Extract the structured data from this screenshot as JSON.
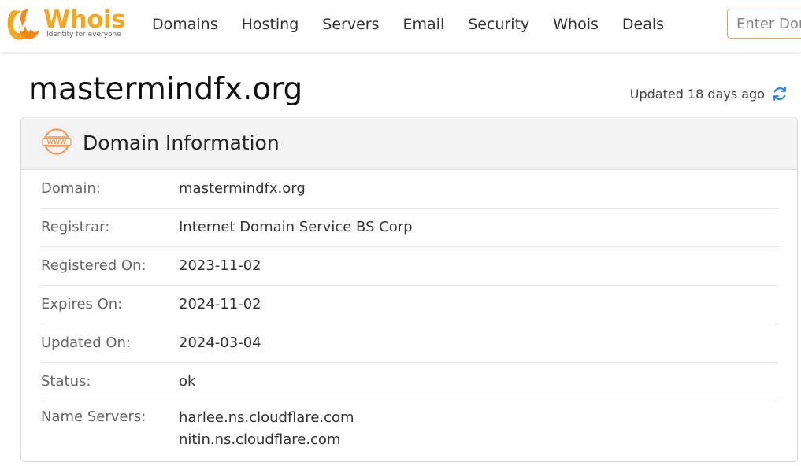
{
  "header": {
    "logo_word": "Whois",
    "logo_tagline": "Identity for everyone",
    "nav": [
      "Domains",
      "Hosting",
      "Servers",
      "Email",
      "Security",
      "Whois",
      "Deals"
    ],
    "search_placeholder": "Enter Domain"
  },
  "page": {
    "title": "mastermindfx.org",
    "updated_text": "Updated 18 days ago"
  },
  "card": {
    "title": "Domain Information",
    "icon": "www-icon",
    "rows": [
      {
        "label": "Domain:",
        "value": "mastermindfx.org"
      },
      {
        "label": "Registrar:",
        "value": "Internet Domain Service BS Corp"
      },
      {
        "label": "Registered On:",
        "value": "2023-11-02"
      },
      {
        "label": "Expires On:",
        "value": "2024-11-02"
      },
      {
        "label": "Updated On:",
        "value": "2024-03-04"
      },
      {
        "label": "Status:",
        "value": "ok"
      }
    ],
    "name_servers": {
      "label": "Name Servers:",
      "values": [
        "harlee.ns.cloudflare.com",
        "nitin.ns.cloudflare.com"
      ]
    }
  },
  "colors": {
    "brand_orange": "#f5a623",
    "refresh_blue": "#2f80ed",
    "search_border": "#e0a46a"
  }
}
